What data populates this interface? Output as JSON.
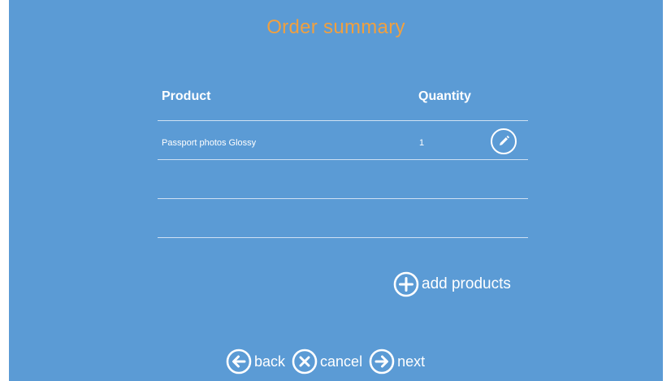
{
  "page": {
    "title": "Order summary"
  },
  "table": {
    "headers": {
      "product": "Product",
      "quantity": "Quantity"
    },
    "rows": [
      {
        "product": "Passport photos Glossy",
        "quantity": "1"
      },
      {
        "product": "",
        "quantity": ""
      },
      {
        "product": "",
        "quantity": ""
      }
    ]
  },
  "actions": {
    "add_products": "add products"
  },
  "nav": {
    "back": "back",
    "cancel": "cancel",
    "next": "next"
  },
  "icons": {
    "edit": "pencil-icon",
    "add": "plus-circle-icon",
    "back": "arrow-left-circle-icon",
    "cancel": "x-circle-icon",
    "next": "arrow-right-circle-icon"
  },
  "colors": {
    "background": "#5b9bd5",
    "title": "#f0a040",
    "text": "#ffffff",
    "divider": "#cfe1f3"
  }
}
